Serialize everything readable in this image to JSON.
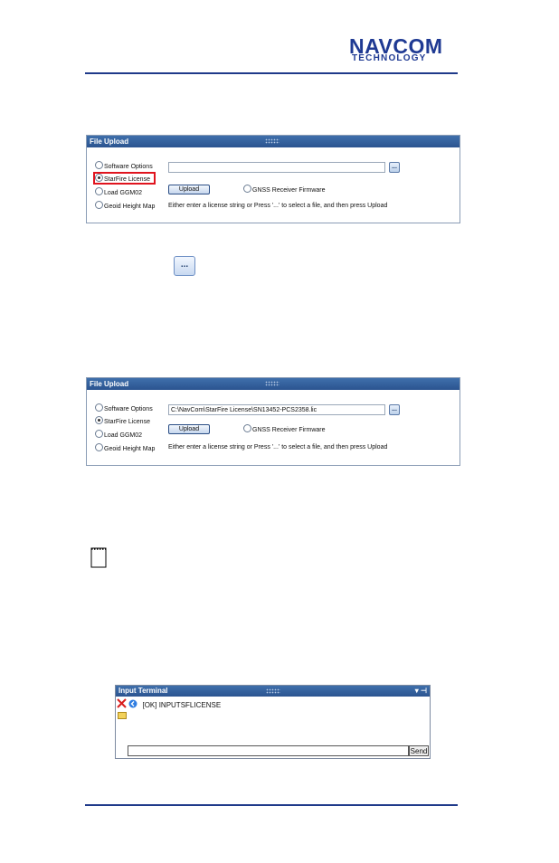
{
  "logo": {
    "line1": "NAVCOM",
    "line2": "TECHNOLOGY"
  },
  "upload_panel": {
    "title": "File Upload",
    "radio_options": [
      "Software Options",
      "StarFire License",
      "Load GGM02",
      "Geoid Height Map"
    ],
    "upload_label": "Upload",
    "browse_label": "...",
    "gnss_label": "GNSS Receiver Firmware",
    "hint": "Either enter a license string or Press '...' to select a file, and then press Upload"
  },
  "panel1": {
    "selected": "StarFire License",
    "path_value": ""
  },
  "panel2": {
    "selected": "StarFire License",
    "path_value": "C:\\NavCom\\StarFire License\\SN13452-PCS2358.lic"
  },
  "standalone_button_label": "...",
  "terminal": {
    "title": "Input Terminal",
    "response": "[OK] INPUTSFLICENSE",
    "send_label": "Send",
    "colors": {
      "titlebar": "#2f5c9a",
      "close_icon": "#d81e1e",
      "back_icon": "#2f7de1"
    }
  },
  "colors": {
    "rule": "#1f3a8a",
    "logo": "#1f3a93",
    "highlight": "#e0141e"
  }
}
